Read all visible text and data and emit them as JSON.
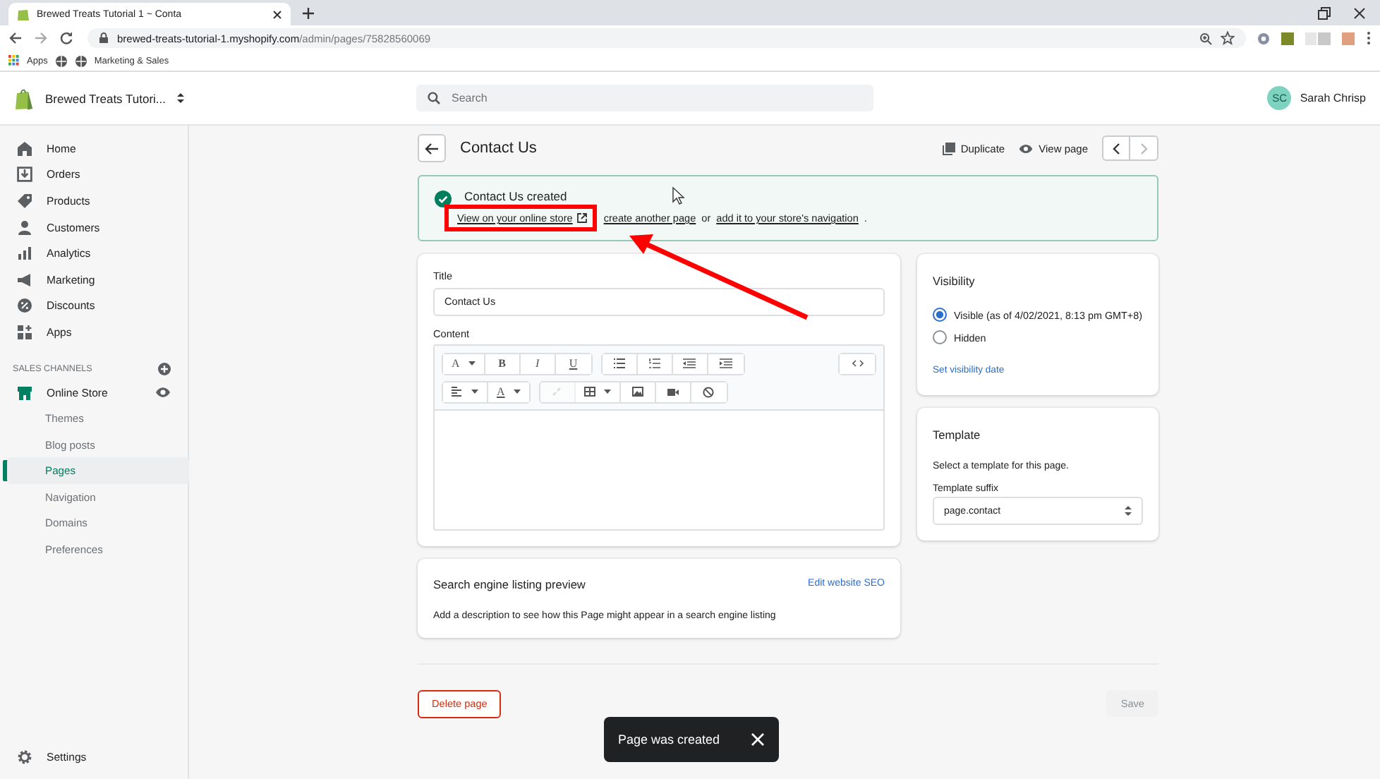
{
  "browser": {
    "tab_title": "Brewed Treats Tutorial 1 ~ Conta",
    "url_host": "brewed-treats-tutorial-1.myshopify.com",
    "url_path": "/admin/pages/75828560069",
    "bookmarks": [
      "Apps",
      "Marketing & Sales"
    ]
  },
  "topbar": {
    "store_name": "Brewed Treats Tutori...",
    "search": {
      "placeholder": "Search"
    },
    "user": {
      "initials": "SC",
      "name": "Sarah Chrisp"
    }
  },
  "sidebar": {
    "items": [
      {
        "label": "Home",
        "selected": false
      },
      {
        "label": "Orders",
        "selected": false
      },
      {
        "label": "Products",
        "selected": false
      },
      {
        "label": "Customers",
        "selected": false
      },
      {
        "label": "Analytics",
        "selected": false
      },
      {
        "label": "Marketing",
        "selected": false
      },
      {
        "label": "Discounts",
        "selected": false
      },
      {
        "label": "Apps",
        "selected": false
      }
    ],
    "section_title": "SALES CHANNELS",
    "channel": {
      "label": "Online Store",
      "children": [
        {
          "label": "Themes",
          "selected": false
        },
        {
          "label": "Blog posts",
          "selected": false
        },
        {
          "label": "Pages",
          "selected": true
        },
        {
          "label": "Navigation",
          "selected": false
        },
        {
          "label": "Domains",
          "selected": false
        },
        {
          "label": "Preferences",
          "selected": false
        }
      ]
    },
    "settings": "Settings"
  },
  "page": {
    "title": "Contact Us",
    "actions": [
      "Duplicate",
      "View page"
    ]
  },
  "banner": {
    "title": "Contact Us created",
    "segments": [
      {
        "kind": "link",
        "text": "View on your online store"
      },
      {
        "kind": "link",
        "text": "create another page"
      },
      {
        "kind": "text",
        "text": "or"
      },
      {
        "kind": "link",
        "text": "add it to your store's navigation"
      },
      {
        "kind": "text",
        "text": "."
      }
    ]
  },
  "editor": {
    "title_label": "Title",
    "title_value": "Contact Us",
    "content_label": "Content",
    "toolbar": [
      [
        [
          {
            "kind": "font",
            "label": "A",
            "disabled": false
          },
          {
            "kind": "bold",
            "label": "B",
            "disabled": false
          },
          {
            "kind": "italic",
            "label": "I",
            "disabled": false
          },
          {
            "kind": "underline",
            "label": "U",
            "disabled": false
          }
        ],
        [
          {
            "kind": "bullets",
            "disabled": false
          },
          {
            "kind": "numbers",
            "disabled": false
          },
          {
            "kind": "outdent",
            "disabled": false
          },
          {
            "kind": "indent",
            "disabled": false
          }
        ],
        [
          {
            "kind": "code",
            "disabled": false
          }
        ]
      ],
      [
        [
          {
            "kind": "align",
            "disabled": false
          },
          {
            "kind": "color",
            "label": "A",
            "disabled": false
          }
        ],
        [
          {
            "kind": "link",
            "disabled": true
          },
          {
            "kind": "table",
            "disabled": false
          },
          {
            "kind": "image",
            "disabled": false
          },
          {
            "kind": "video",
            "disabled": false
          },
          {
            "kind": "clear",
            "disabled": false
          }
        ]
      ]
    ]
  },
  "visibility": {
    "heading": "Visibility",
    "options": [
      {
        "label": "Visible (as of 4/02/2021, 8:13 pm GMT+8)",
        "selected": true
      },
      {
        "label": "Hidden",
        "selected": false
      }
    ],
    "link": "Set visibility date"
  },
  "template": {
    "heading": "Template",
    "description": "Select a template for this page.",
    "field_label": "Template suffix",
    "value": "page.contact"
  },
  "seo": {
    "heading": "Search engine listing preview",
    "link": "Edit website SEO",
    "description": "Add a description to see how this Page might appear in a search engine listing"
  },
  "footer": {
    "delete": "Delete page",
    "save": {
      "label": "Save",
      "disabled": true
    }
  },
  "toast": {
    "message": "Page was created"
  }
}
